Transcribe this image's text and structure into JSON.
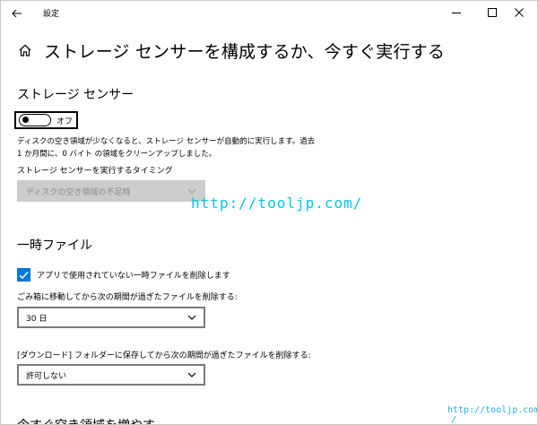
{
  "titlebar": {
    "app_title": "設定",
    "icons": {
      "back": "back-arrow-icon",
      "minimize": "minimize-icon",
      "maximize": "maximize-icon",
      "close": "close-icon"
    }
  },
  "header": {
    "icon": "home-icon",
    "title": "ストレージ センサーを構成するか、今すぐ実行する"
  },
  "storage_sense": {
    "section_title": "ストレージ センサー",
    "toggle_state": "オフ",
    "toggle_on": false,
    "description": "ディスクの空き領域が少なくなると、ストレージ センサーが自動的に実行します。過去 1 か月間に、0 バイト の領域をクリーンアップしました。",
    "run_timing_label": "ストレージ センサーを実行するタイミング",
    "run_timing_value": "ディスクの空き領域の不足時"
  },
  "temp_files": {
    "section_title": "一時ファイル",
    "delete_unused_label": "アプリで使用されていない一時ファイルを削除します",
    "delete_unused_checked": true,
    "recycle_bin_label": "ごみ箱に移動してから次の期間が過ぎたファイルを削除する:",
    "recycle_bin_value": "30 日",
    "downloads_label": "[ダウンロード] フォルダーに保存してから次の期間が過ぎたファイルを削除する:",
    "downloads_value": "許可しない"
  },
  "next_section_title_partial": "今すぐ空き領域を増やす",
  "watermark": {
    "main": "http://tooljp.com/",
    "corner": "http://tooljp.com",
    "corner_slash": "/"
  },
  "colors": {
    "accent": "#0078d7",
    "watermark": "#00c8e8",
    "disabled_bg": "#cccccc",
    "disabled_text": "#8a8a8a"
  }
}
